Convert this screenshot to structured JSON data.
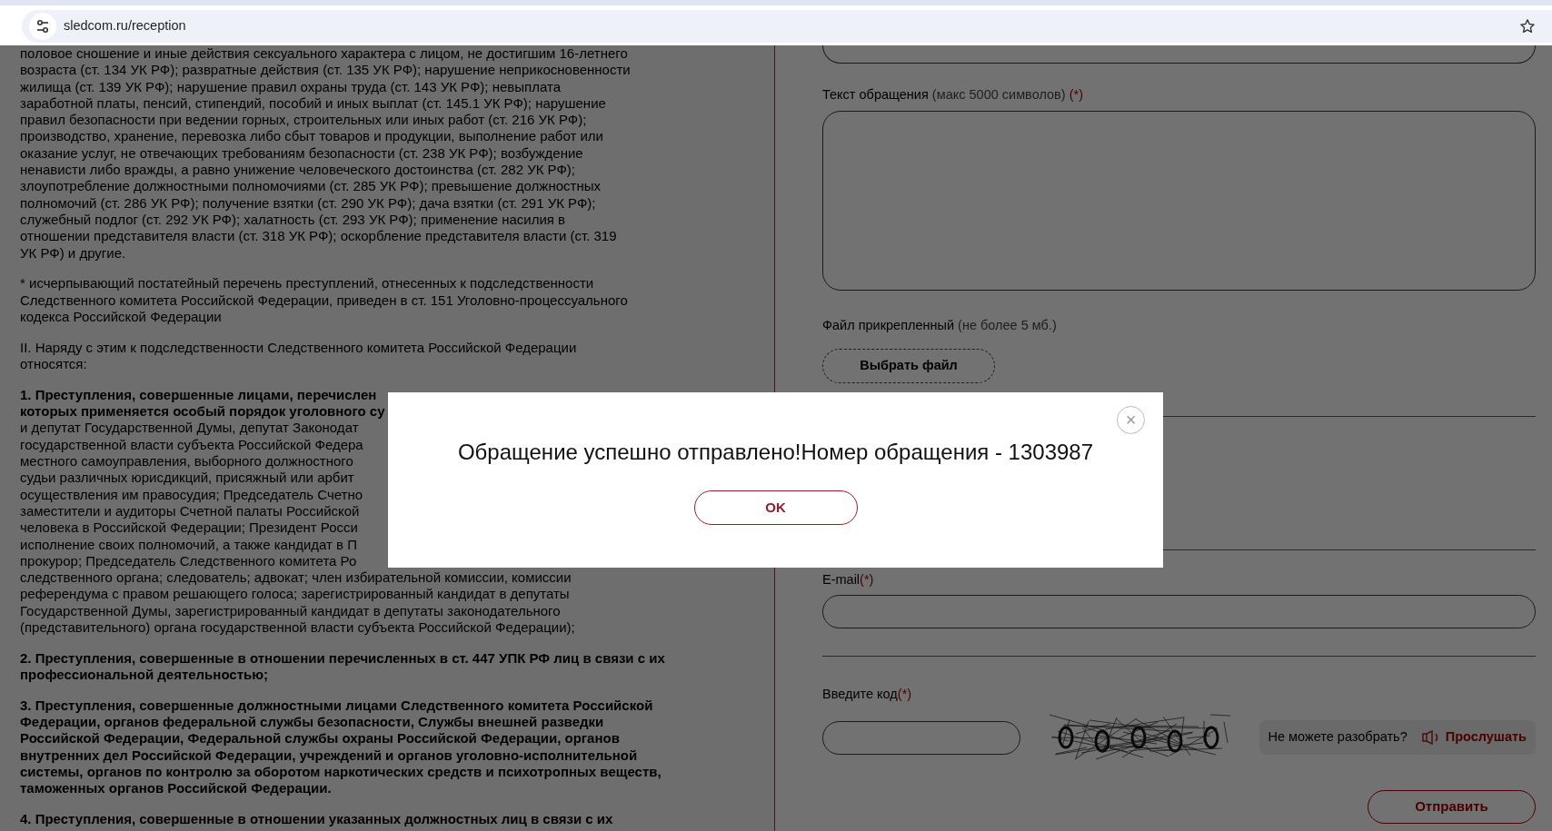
{
  "browser": {
    "url": "sledcom.ru/reception"
  },
  "article": {
    "paragraphs": [
      {
        "bold": false,
        "lines": [
          "половое сношение и иные действия сексуального характера с лицом, не достигшим 16-летнего",
          "возраста (ст. 134 УК РФ); развратные действия (ст. 135 УК РФ); нарушение неприкосновенности",
          "жилища (ст. 139 УК РФ); нарушение правил охраны труда (ст. 143 УК РФ); невыплата",
          "заработной платы, пенсий, стипендий, пособий и иных выплат (ст. 145.1 УК РФ); нарушение",
          "правил безопасности при ведении горных, строительных или иных работ (ст. 216 УК РФ);",
          "производство, хранение, перевозка либо сбыт товаров и продукции, выполнение работ или",
          "оказание услуг, не отвечающих требованиям безопасности (ст. 238 УК РФ); возбуждение",
          "ненависти либо вражды, а равно унижение человеческого достоинства (ст. 282 УК РФ);",
          "злоупотребление должностными полномочиями (ст. 285 УК РФ); превышение должностных",
          "полномочий (ст. 286 УК РФ); получение взятки (ст. 290 УК РФ); дача взятки (ст. 291 УК РФ);",
          "служебный подлог (ст. 292 УК РФ); халатность (ст. 293 УК РФ); применение насилия в",
          "отношении представителя власти (ст. 318 УК РФ); оскорбление представителя власти (ст. 319",
          "УК РФ) и другие."
        ]
      },
      {
        "bold": false,
        "lines": [
          "* исчерпывающий постатейный перечень преступлений, отнесенных к подследственности",
          "Следственного комитета Российской Федерации, приведен в ст. 151 Уголовно-процессуального",
          "кодекса Российской Федерации"
        ]
      },
      {
        "bold": false,
        "lines": [
          "II. Наряду с этим к подследственности Следственного комитета Российской Федерации",
          "относятся:"
        ]
      },
      {
        "bold": false,
        "lines": [
          "**1. Преступления, совершенные лицами,  перечислен**",
          "**которых применяется особый порядок уголовного су**",
          "и депутат Государственной Думы, депутат Законодат",
          "государственной власти субъекта Российской Федера",
          "местного самоуправления, выборного должностного",
          "судьи различных юрисдикций, присяжный или арбит",
          "осуществления им правосудия; Председатель Счетно",
          "заместители и аудиторы Счетной палаты Российской",
          "человека в Российской Федерации; Президент Росси",
          "исполнение своих полномочий, а также кандидат в П",
          "прокурор; Председатель Следственного комитета Ро",
          "следственного органа; следователь; адвокат; член избирательной комиссии, комиссии",
          "референдума с правом решающего голоса; зарегистрированный кандидат в депутаты",
          "Государственной Думы, зарегистрированный кандидат в депутаты законодательного",
          "(представительного) органа государственной власти субъекта Российской Федерации);"
        ]
      },
      {
        "bold": true,
        "lines": [
          "2. Преступления, совершенные в отношении перечисленных в ст. 447 УПК РФ лиц в связи с их",
          "профессиональной деятельностью;"
        ]
      },
      {
        "bold": true,
        "lines": [
          "3. Преступления, совершенные должностными лицами Следственного комитета Российской",
          "Федерации, органов федеральной службы безопасности, Службы внешней разведки",
          "Российской Федерации, Федеральной службы охраны Российской Федерации, органов",
          "внутренних дел Российской Федерации, учреждений и органов уголовно-исполнительной",
          "системы, органов по контролю за оборотом наркотических средств и психотропных веществ,",
          "таможенных органов Российской Федерации."
        ]
      },
      {
        "bold": true,
        "lines": [
          "4. Преступления, совершенные в отношении указанных должностных лиц в связи с их"
        ]
      }
    ]
  },
  "form": {
    "message": {
      "label": "Текст обращения",
      "hint": "(макс 5000 символов)",
      "required_mark": "(*)"
    },
    "attachment": {
      "label": "Файл прикрепленный",
      "hint": "(не более 5 мб.)",
      "button": "Выбрать файл"
    },
    "email": {
      "label": "E-mail",
      "required_mark": "(*)"
    },
    "captcha": {
      "label": "Введите код",
      "required_mark": "(*)",
      "help": "Не можете разобрать?",
      "listen": "Прослушать"
    },
    "submit": "Отправить"
  },
  "dialog": {
    "message": "Обращение успешно отправлено!Номер обращения - 1303987",
    "ok": "OK",
    "close": "×"
  }
}
